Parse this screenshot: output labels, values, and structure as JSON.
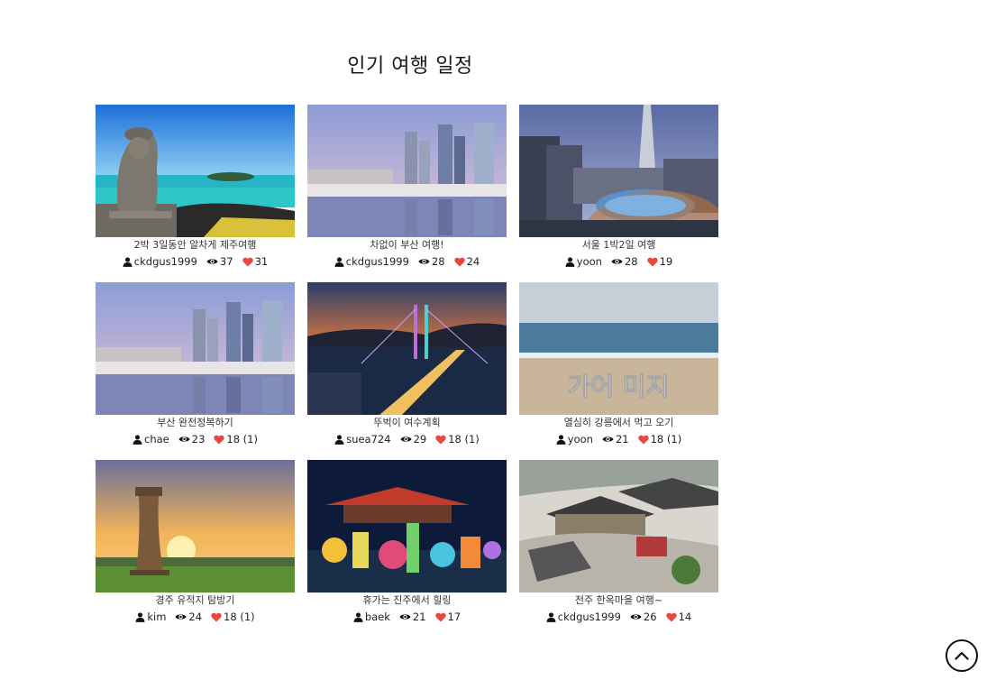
{
  "page_title": "인기 여행 일정",
  "colors": {
    "heart": "#e8483f",
    "text": "#222222"
  },
  "icons": {
    "author": "user-icon",
    "views": "eye-icon",
    "likes": "heart-icon",
    "scroll_top": "chevron-up-icon"
  },
  "cards": [
    {
      "title": "2박 3일동안 알차게 제주여행",
      "author": "ckdgus1999",
      "views": "37",
      "likes": "31",
      "image": "jeju-stone-statue"
    },
    {
      "title": "차없이 부산 여행!",
      "author": "ckdgus1999",
      "views": "28",
      "likes": "24",
      "image": "busan-marina"
    },
    {
      "title": "서울 1박2일 여행",
      "author": "yoon",
      "views": "28",
      "likes": "19",
      "image": "seoul-lotte-tower"
    },
    {
      "title": "부산 완전정복하기",
      "author": "chae",
      "views": "23",
      "likes": "18 (1)",
      "image": "busan-marina"
    },
    {
      "title": "뚜벅이 여수계획",
      "author": "suea724",
      "views": "29",
      "likes": "18 (1)",
      "image": "yeosu-bridge"
    },
    {
      "title": "열심히 강릉에서 먹고 오기",
      "author": "yoon",
      "views": "21",
      "likes": "18 (1)",
      "image": "gangneung-beach"
    },
    {
      "title": "경주 유적지 탐방기",
      "author": "kim",
      "views": "24",
      "likes": "18 (1)",
      "image": "gyeongju-cheomseongdae"
    },
    {
      "title": "휴가는 진주에서 힐링",
      "author": "baek",
      "views": "21",
      "likes": "17",
      "image": "jinju-lantern-festival"
    },
    {
      "title": "전주 한옥마을 여행~",
      "author": "ckdgus1999",
      "views": "26",
      "likes": "14",
      "image": "jeonju-hanok-village"
    }
  ]
}
